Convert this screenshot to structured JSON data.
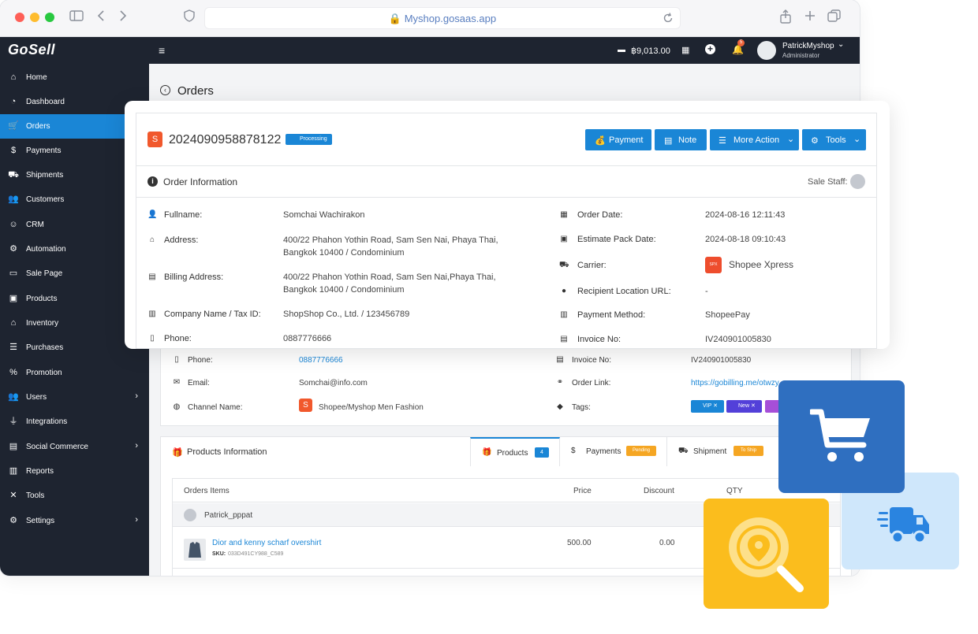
{
  "browser": {
    "url": "Myshop.gosaas.app"
  },
  "topbar": {
    "balance": "฿9,013.00",
    "notif_count": "5",
    "user_name": "PatrickMyshop",
    "user_role": "Administrator"
  },
  "logo": "GoSell",
  "sidebar": {
    "items": [
      {
        "label": "Home",
        "icon": "home-icon"
      },
      {
        "label": "Dashboard",
        "icon": "dashboard-icon"
      },
      {
        "label": "Orders",
        "icon": "cart-icon"
      },
      {
        "label": "Payments",
        "icon": "money-bag-icon"
      },
      {
        "label": "Shipments",
        "icon": "truck-icon"
      },
      {
        "label": "Customers",
        "icon": "users-icon"
      },
      {
        "label": "CRM",
        "icon": "crm-icon"
      },
      {
        "label": "Automation",
        "icon": "robot-icon"
      },
      {
        "label": "Sale Page",
        "icon": "page-icon"
      },
      {
        "label": "Products",
        "icon": "boxes-icon"
      },
      {
        "label": "Inventory",
        "icon": "warehouse-icon"
      },
      {
        "label": "Purchases",
        "icon": "purchases-icon"
      },
      {
        "label": "Promotion",
        "icon": "percent-icon"
      },
      {
        "label": "Users",
        "icon": "users-cog-icon"
      },
      {
        "label": "Integrations",
        "icon": "plug-icon"
      },
      {
        "label": "Social Commerce",
        "icon": "social-icon"
      },
      {
        "label": "Reports",
        "icon": "reports-icon"
      },
      {
        "label": "Tools",
        "icon": "tools-icon"
      },
      {
        "label": "Settings",
        "icon": "gear-icon"
      }
    ]
  },
  "page": {
    "title": "Orders"
  },
  "order": {
    "number": "2024090958878122",
    "status": "Processing",
    "buttons": {
      "payment": "Payment",
      "note": "Note",
      "more": "More Action",
      "tools": "Tools"
    }
  },
  "info": {
    "title": "Order Information",
    "sale_staff": "Sale Staff:",
    "left": [
      {
        "label": "Fullname:",
        "value": "Somchai Wachirakon"
      },
      {
        "label": "Address:",
        "value": "400/22 Phahon Yothin Road, Sam Sen Nai, Phaya Thai,",
        "value2": "Bangkok 10400  / Condominium"
      },
      {
        "label": "Billing Address:",
        "value": "400/22 Phahon Yothin Road, Sam Sen Nai,Phaya Thai,",
        "value2": "Bangkok 10400  / Condominium"
      },
      {
        "label": "Company Name / Tax ID:",
        "value": "ShopShop Co., Ltd. / 123456789"
      },
      {
        "label": "Phone:",
        "value": "0887776666"
      }
    ],
    "right": [
      {
        "label": "Order Date:",
        "value": "2024-08-16 12:11:43"
      },
      {
        "label": "Estimate Pack Date:",
        "value": "2024-08-18 09:10:43"
      },
      {
        "label": "Carrier:",
        "value": "Shopee Xpress"
      },
      {
        "label": "Recipient Location URL:",
        "value": "-"
      },
      {
        "label": "Payment Method:",
        "value": "ShopeePay"
      },
      {
        "label": "Invoice No:",
        "value": "IV240901005830"
      }
    ]
  },
  "behind": {
    "phone_label": "Phone:",
    "phone": "0887776666",
    "email_label": "Email:",
    "email": "Somchai@info.com",
    "channel_label": "Channel Name:",
    "channel": "Shopee/Myshop Men Fashion",
    "invoice_label": "Invoice No:",
    "invoice": "IV240901005830",
    "link_label": "Order Link:",
    "link": "https://gobilling.me/otwzy",
    "tags_label": "Tags:",
    "tags": [
      "VIP",
      "New"
    ]
  },
  "products": {
    "title": "Products Information",
    "tabs": [
      {
        "label": "Products",
        "badge": "4"
      },
      {
        "label": "Payments",
        "badge": "Pending"
      },
      {
        "label": "Shipment",
        "badge": "To Ship"
      }
    ],
    "columns": [
      "Orders Items",
      "Price",
      "Discount",
      "QTY"
    ],
    "group": "Patrick_pppat",
    "items": [
      {
        "name": "Dior and kenny scharf overshirt",
        "sku_label": "SKU:",
        "sku": "033D491CY988_C589",
        "price": "500.00",
        "discount": "0.00"
      }
    ]
  },
  "colors": {
    "primary": "#1a86d6",
    "sidebar": "#1e2430",
    "tile_blue": "#2f6fc0",
    "tile_yellow": "#fbbd1d",
    "tile_light": "#cfe7fb"
  }
}
